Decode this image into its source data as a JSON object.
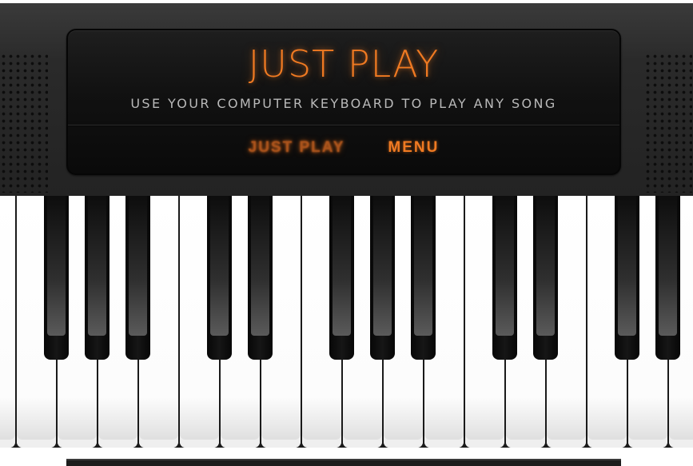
{
  "display": {
    "title": "JUST PLAY",
    "subtitle": "USE YOUR COMPUTER KEYBOARD TO PLAY ANY SONG",
    "nav": [
      {
        "label": "JUST PLAY",
        "active": true
      },
      {
        "label": "MENU",
        "active": false
      }
    ]
  },
  "colors": {
    "accent": "#f07a22",
    "panel": "#232323",
    "display_bg": "#111111"
  },
  "keyboard": {
    "white_key_count": 17,
    "black_key_count": 12
  }
}
